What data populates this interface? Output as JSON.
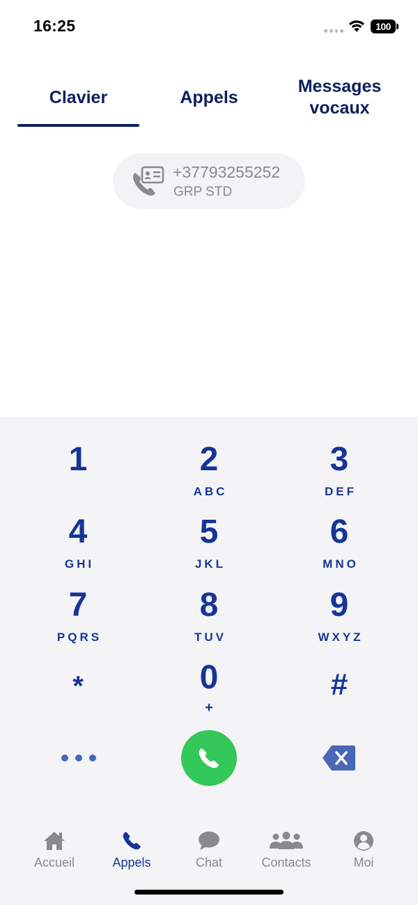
{
  "status_bar": {
    "time": "16:25",
    "battery": "100",
    "icons": [
      "signal-dots-icon",
      "wifi-icon",
      "battery-icon"
    ]
  },
  "tabs": [
    {
      "label": "Clavier",
      "active": true
    },
    {
      "label": "Appels",
      "active": false
    },
    {
      "label": "Messages vocaux",
      "active": false
    }
  ],
  "caller_id": {
    "number": "+37793255252",
    "label": "GRP STD",
    "icon": "phone-contact-card-icon"
  },
  "keypad": {
    "keys": [
      {
        "digit": "1",
        "letters": ""
      },
      {
        "digit": "2",
        "letters": "ABC"
      },
      {
        "digit": "3",
        "letters": "DEF"
      },
      {
        "digit": "4",
        "letters": "GHI"
      },
      {
        "digit": "5",
        "letters": "JKL"
      },
      {
        "digit": "6",
        "letters": "MNO"
      },
      {
        "digit": "7",
        "letters": "PQRS"
      },
      {
        "digit": "8",
        "letters": "TUV"
      },
      {
        "digit": "9",
        "letters": "WXYZ"
      },
      {
        "digit": "*",
        "letters": ""
      },
      {
        "digit": "0",
        "letters": "+"
      },
      {
        "digit": "#",
        "letters": ""
      }
    ],
    "actions": {
      "more_icon": "more-dots-icon",
      "call_icon": "phone-icon",
      "backspace_icon": "backspace-icon"
    }
  },
  "bottom_nav": [
    {
      "label": "Accueil",
      "icon": "home-icon",
      "active": false
    },
    {
      "label": "Appels",
      "icon": "phone-icon",
      "active": true
    },
    {
      "label": "Chat",
      "icon": "chat-bubble-icon",
      "active": false
    },
    {
      "label": "Contacts",
      "icon": "contacts-group-icon",
      "active": false
    },
    {
      "label": "Moi",
      "icon": "user-circle-icon",
      "active": false
    }
  ],
  "colors": {
    "primary_dark": "#0b1f5c",
    "keypad_blue": "#163596",
    "call_green": "#34c759",
    "muted_gray": "#8a8a8e",
    "keypad_background": "#f4f4f7"
  }
}
